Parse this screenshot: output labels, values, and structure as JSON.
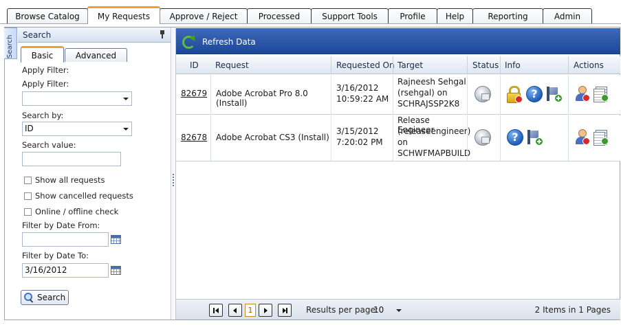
{
  "tabs": [
    {
      "label": "Browse Catalog",
      "active": false
    },
    {
      "label": "My Requests",
      "active": true
    },
    {
      "label": "Approve / Reject",
      "active": false
    },
    {
      "label": "Processed",
      "active": false
    },
    {
      "label": "Support Tools",
      "active": false
    },
    {
      "label": "Profile",
      "active": false
    },
    {
      "label": "Help",
      "active": false
    },
    {
      "label": "Reporting",
      "active": false
    },
    {
      "label": "Admin",
      "active": false
    }
  ],
  "side_tab": {
    "label": "Search"
  },
  "search_panel": {
    "title": "Search",
    "subtabs": [
      {
        "label": "Basic",
        "active": true
      },
      {
        "label": "Advanced",
        "active": false
      }
    ],
    "apply_filter_label_1": "Apply Filter:",
    "apply_filter_label_2": "Apply Filter:",
    "apply_filter_value": "",
    "search_by_label": "Search by:",
    "search_by_value": "ID",
    "search_value_label": "Search value:",
    "search_value": "",
    "checkboxes": [
      {
        "label": "Show all requests",
        "checked": false
      },
      {
        "label": "Show cancelled requests",
        "checked": false
      },
      {
        "label": "Online / offline check",
        "checked": false
      }
    ],
    "date_from_label": "Filter by Date From:",
    "date_from_value": "",
    "date_to_label": "Filter by Date To:",
    "date_to_value": "3/16/2012",
    "search_button": "Search"
  },
  "toolbar": {
    "refresh_label": "Refresh Data",
    "accent": "#1f4c9e"
  },
  "table": {
    "columns": [
      "ID",
      "Request",
      "Requested On",
      "Target",
      "Status",
      "Info",
      "Actions"
    ],
    "rows": [
      {
        "id": "82679",
        "request": "Adobe Acrobat Pro 8.0 (Install)",
        "requested_on_date": "3/16/2012",
        "requested_on_time": "10:59:22 AM",
        "target": [
          "Rajneesh Sehgal",
          "(rsehgal) on",
          "SCHRAJSSP2K8"
        ],
        "status_icon": "status-monitor-icon",
        "info_icons": [
          "lock-icon",
          "help-icon",
          "add-flag-icon"
        ],
        "action_icons": [
          "cancel-user-icon",
          "details-list-icon"
        ]
      },
      {
        "id": "82678",
        "request": "Adobe Acrobat CS3 (Install)",
        "requested_on_date": "3/15/2012",
        "requested_on_time": "7:20:02 PM",
        "target": [
          "Release Engineer",
          "(releaseengineer)",
          "on",
          "SCHWFMAPBUILD"
        ],
        "status_icon": "status-monitor-icon",
        "info_icons": [
          "help-icon",
          "add-flag-icon"
        ],
        "action_icons": [
          "cancel-user-icon",
          "details-list-icon"
        ]
      }
    ]
  },
  "pager": {
    "current_page": "1",
    "results_per_page_label": "Results per page:",
    "results_per_page_value": "10",
    "summary": "2 Items in 1 Pages"
  }
}
